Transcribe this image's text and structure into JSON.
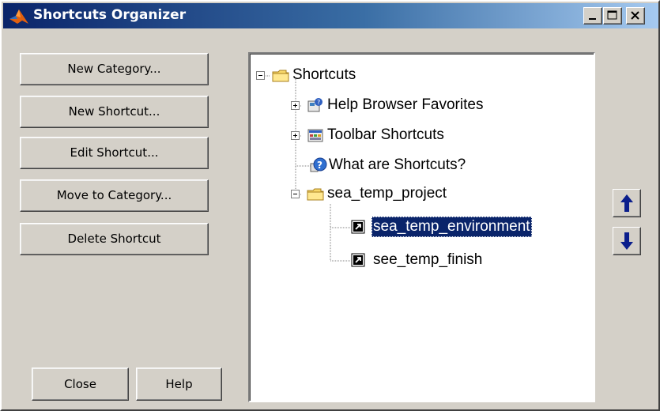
{
  "window": {
    "title": "Shortcuts Organizer",
    "controls": {
      "minimize": "minimize-icon",
      "maximize": "maximize-icon",
      "close": "close-icon"
    }
  },
  "actions": {
    "new_category": "New Category...",
    "new_shortcut": "New Shortcut...",
    "edit_shortcut": "Edit Shortcut...",
    "move_to_category": "Move to Category...",
    "delete_shortcut": "Delete Shortcut",
    "close": "Close",
    "help": "Help"
  },
  "tree": {
    "root": {
      "label": "Shortcuts",
      "icon": "folder-icon",
      "expanded": true
    },
    "items": [
      {
        "label": "Help Browser Favorites",
        "icon": "help-favorites-icon",
        "expandable": true,
        "expanded": false
      },
      {
        "label": "Toolbar Shortcuts",
        "icon": "toolbar-icon",
        "expandable": true,
        "expanded": false
      },
      {
        "label": "What are Shortcuts?",
        "icon": "help-icon",
        "expandable": false
      },
      {
        "label": "sea_temp_project",
        "icon": "folder-icon",
        "expandable": true,
        "expanded": true,
        "children": [
          {
            "label": "sea_temp_environment",
            "icon": "shortcut-icon",
            "selected": true
          },
          {
            "label": "see_temp_finish",
            "icon": "shortcut-icon",
            "selected": false
          }
        ]
      }
    ]
  },
  "reorder": {
    "up": "arrow-up-icon",
    "down": "arrow-down-icon"
  },
  "colors": {
    "selection": "#0a246a",
    "titlebar_start": "#0a246a",
    "titlebar_end": "#a6caf0",
    "face": "#d4d0c8"
  }
}
